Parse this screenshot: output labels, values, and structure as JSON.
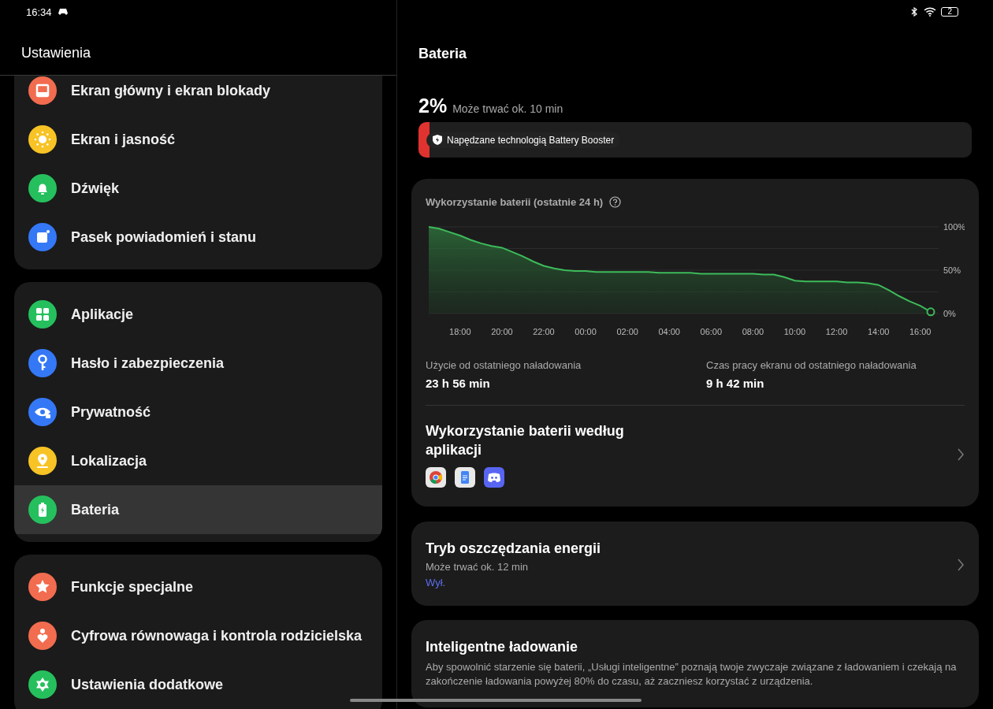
{
  "status_bar": {
    "time": "16:34",
    "battery": "2"
  },
  "sidebar": {
    "title": "Ustawienia",
    "groups": [
      {
        "items": [
          {
            "label": "Ekran główny i ekran blokady",
            "kind": "home",
            "color": "#f26c4f",
            "selected": false
          },
          {
            "label": "Ekran i jasność",
            "kind": "sun",
            "color": "#f7c325",
            "selected": false
          },
          {
            "label": "Dźwięk",
            "kind": "bell",
            "color": "#25c05d",
            "selected": false
          },
          {
            "label": "Pasek powiadomień i stanu",
            "kind": "note",
            "color": "#3478f6",
            "selected": false
          }
        ]
      },
      {
        "items": [
          {
            "label": "Aplikacje",
            "kind": "grid",
            "color": "#25c05d",
            "selected": false
          },
          {
            "label": "Hasło i zabezpieczenia",
            "kind": "key",
            "color": "#3478f6",
            "selected": false
          },
          {
            "label": "Prywatność",
            "kind": "eye",
            "color": "#3478f6",
            "selected": false
          },
          {
            "label": "Lokalizacja",
            "kind": "pin",
            "color": "#f7c325",
            "selected": false
          },
          {
            "label": "Bateria",
            "kind": "battery",
            "color": "#25c05d",
            "selected": true
          }
        ]
      },
      {
        "items": [
          {
            "label": "Funkcje specjalne",
            "kind": "star",
            "color": "#f26c4f",
            "selected": false
          },
          {
            "label": "Cyfrowa równowaga i kontrola rodzicielska",
            "kind": "heart",
            "color": "#f26c4f",
            "selected": false
          },
          {
            "label": "Ustawienia dodatkowe",
            "kind": "gear",
            "color": "#25c05d",
            "selected": false
          }
        ]
      }
    ]
  },
  "detail": {
    "title": "Bateria",
    "percent": "2%",
    "estimate": "Może trwać ok. 10 min",
    "battery_bar": {
      "level": 0.02,
      "badge": "Napędzane technologią Battery Booster"
    },
    "usage_card": {
      "title": "Wykorzystanie baterii (ostatnie 24 h)",
      "chart_data": {
        "type": "area",
        "categories": [
          null,
          null,
          null,
          null,
          "18:00",
          null,
          null,
          null,
          "20:00",
          null,
          null,
          null,
          "22:00",
          null,
          null,
          null,
          "00:00",
          null,
          null,
          null,
          "02:00",
          null,
          null,
          null,
          "04:00",
          null,
          null,
          null,
          "06:00",
          null,
          null,
          null,
          "08:00",
          null,
          null,
          null,
          "10:00",
          null,
          null,
          null,
          "12:00",
          null,
          null,
          null,
          "14:00",
          null,
          null,
          null,
          "16:00",
          null
        ],
        "series": [
          {
            "color": "#3dbb5a",
            "values": [
              null,
              100,
              98,
              94,
              90,
              85,
              81,
              78,
              76,
              71,
              66,
              60,
              55,
              52,
              50,
              49,
              49,
              48,
              48,
              48,
              48,
              48,
              48,
              47,
              47,
              47,
              47,
              46,
              46,
              46,
              46,
              46,
              46,
              45,
              45,
              42,
              38,
              37,
              37,
              37,
              37,
              36,
              36,
              35,
              33,
              27,
              20,
              14,
              9,
              2
            ]
          }
        ],
        "ylim": [
          0,
          100
        ],
        "yticks": [
          {
            "value": 100,
            "label": "100%"
          },
          {
            "value": 50,
            "label": "50%"
          },
          {
            "value": 0,
            "label": "0%"
          }
        ]
      },
      "stats": [
        {
          "label": "Użycie od ostatniego naładowania",
          "value": "23 h 56 min"
        },
        {
          "label": "Czas pracy ekranu od ostatniego naładowania",
          "value": "9 h 42 min"
        }
      ],
      "apps_title": "Wykorzystanie baterii według aplikacji"
    },
    "saver": {
      "title": "Tryb oszczędzania energii",
      "subtitle": "Może trwać ok. 12 min",
      "state": "Wył."
    },
    "smart": {
      "title": "Inteligentne ładowanie",
      "text": "Aby spowolnić starzenie się baterii, „Usługi inteligentne” poznają twoje zwyczaje związane z ładowaniem i czekają na zakończenie ładowania powyżej 80% do czasu, aż zaczniesz korzystać z urządzenia."
    }
  }
}
